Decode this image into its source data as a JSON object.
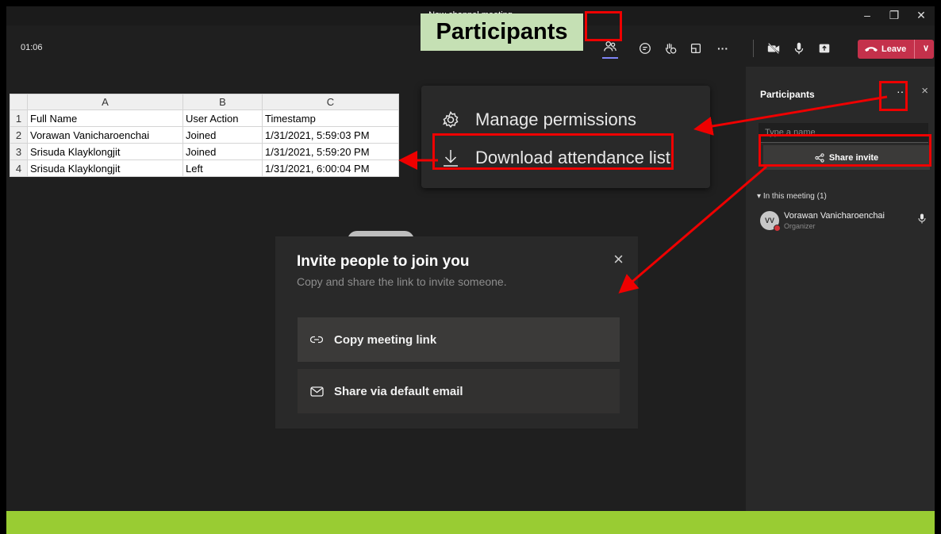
{
  "window": {
    "title": "New channel meeting",
    "controls": [
      "–",
      "❐",
      "✕"
    ]
  },
  "toolbar": {
    "timer": "01:06",
    "participants_callout": "Participants",
    "leave_label": "Leave",
    "icons": [
      "people-icon",
      "chat-icon",
      "reactions-icon",
      "rooms-icon",
      "more-icon",
      "camera-off-icon",
      "mic-icon",
      "share-tray-icon"
    ]
  },
  "spreadsheet": {
    "column_headers": [
      "A",
      "B",
      "C"
    ],
    "row_numbers": [
      "1",
      "2",
      "3",
      "4"
    ],
    "rows": [
      [
        "Full Name",
        "User Action",
        "Timestamp"
      ],
      [
        "Vorawan Vanicharoenchai",
        "Joined",
        "1/31/2021, 5:59:03 PM"
      ],
      [
        "Srisuda Klayklongjit",
        "Joined",
        "1/31/2021, 5:59:20 PM"
      ],
      [
        "Srisuda Klayklongjit",
        "Left",
        "1/31/2021, 6:00:04 PM"
      ]
    ]
  },
  "menu": {
    "manage_permissions": "Manage permissions",
    "download_attendance": "Download attendance list"
  },
  "invite_dialog": {
    "title": "Invite people to join you",
    "subtitle": "Copy and share the link to invite someone.",
    "copy_link": "Copy meeting link",
    "share_email": "Share via default email",
    "close": "×"
  },
  "participants_panel": {
    "title": "Participants",
    "more": "···",
    "close": "×",
    "search_placeholder": "Type a name",
    "share_invite": "Share invite",
    "section_label": "In this meeting (1)",
    "participant": {
      "initials": "VV",
      "name": "Vorawan Vanicharoenchai",
      "role": "Organizer"
    }
  },
  "colors": {
    "highlight_red": "#ee0000",
    "leave_red": "#c4314b",
    "footer_green": "#99cc33",
    "callout_green": "#c5e0b4",
    "accent": "#7f85f5"
  }
}
